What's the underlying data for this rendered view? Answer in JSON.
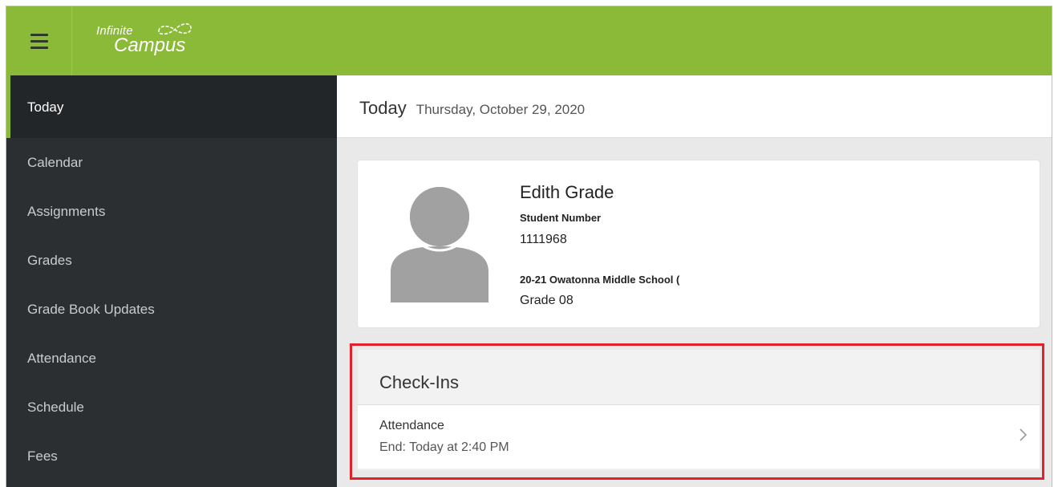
{
  "header": {
    "logo_line1": "Infinite",
    "logo_line2": "Campus",
    "menu_icon": "hamburger-menu-icon"
  },
  "sidebar": {
    "items": [
      {
        "label": "Today",
        "active": true
      },
      {
        "label": "Calendar"
      },
      {
        "label": "Assignments"
      },
      {
        "label": "Grades"
      },
      {
        "label": "Grade Book Updates"
      },
      {
        "label": "Attendance"
      },
      {
        "label": "Schedule"
      },
      {
        "label": "Fees"
      }
    ]
  },
  "main": {
    "title": "Today",
    "date": "Thursday, October 29, 2020"
  },
  "student": {
    "name": "Edith Grade",
    "number_label": "Student Number",
    "number": "1111968",
    "school": "20-21 Owatonna Middle School (",
    "grade": "Grade 08",
    "avatar_icon": "person-avatar-icon"
  },
  "checkins": {
    "title": "Check-Ins",
    "items": [
      {
        "title": "Attendance",
        "subtitle": "End: Today at 2:40 PM",
        "icon": "chevron-right-icon"
      }
    ]
  },
  "colors": {
    "brand_green": "#8aba38",
    "sidebar_bg": "#2b2f31",
    "highlight_red": "#e3212b"
  }
}
